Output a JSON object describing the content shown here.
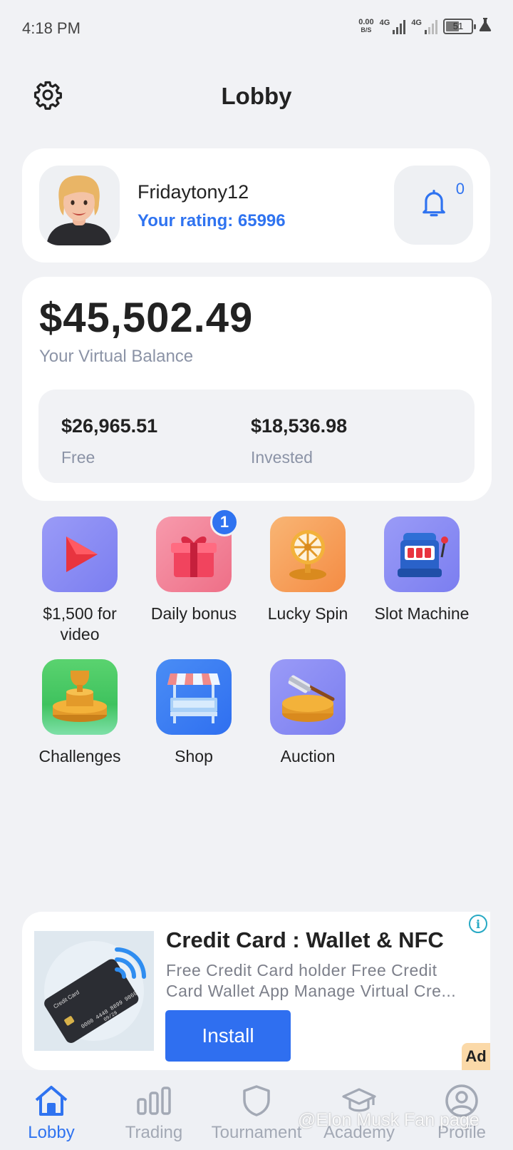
{
  "status_bar": {
    "time": "4:18 PM",
    "net_speed_value": "0.00",
    "net_speed_unit": "B/S",
    "signal_1": "4G",
    "signal_2": "4G",
    "battery": "51"
  },
  "header": {
    "title": "Lobby",
    "settings_icon": "gear-icon"
  },
  "profile": {
    "username": "Fridaytony12",
    "rating": "Your rating: 65996",
    "notification_count": "0",
    "bell_icon": "bell-icon"
  },
  "balance": {
    "amount": "$45,502.49",
    "label": "Your Virtual Balance",
    "free_value": "$26,965.51",
    "free_label": "Free",
    "invested_value": "$18,536.98",
    "invested_label": "Invested"
  },
  "features": [
    {
      "label": "$1,500 for video",
      "icon": "play-icon",
      "color": "#8b8cf5"
    },
    {
      "label": "Daily bonus",
      "icon": "gift-icon",
      "color": "#f27e96",
      "badge": "1"
    },
    {
      "label": "Lucky Spin",
      "icon": "wheel-icon",
      "color": "#f7a35c"
    },
    {
      "label": "Slot Machine",
      "icon": "slot-machine-icon",
      "color": "#8b8cf5"
    },
    {
      "label": "Challenges",
      "icon": "trophy-icon",
      "color": "#44c45e"
    },
    {
      "label": "Shop",
      "icon": "shop-icon",
      "color": "#3b7cf0"
    },
    {
      "label": "Auction",
      "icon": "gavel-icon",
      "color": "#8b8cf5"
    }
  ],
  "ad": {
    "title": "Credit Card : Wallet & NFC",
    "description": "Free Credit Card holder Free Credit Card Wallet App Manage Virtual Cre...",
    "install_label": "Install",
    "tag": "Ad",
    "info_glyph": "i",
    "card_label": "Credit Card",
    "card_number": "0000 4448 8899 9860",
    "card_expiry": "09/28"
  },
  "bottom_nav": [
    {
      "label": "Lobby",
      "icon": "home-icon",
      "active": true
    },
    {
      "label": "Trading",
      "icon": "bar-chart-icon",
      "active": false
    },
    {
      "label": "Tournament",
      "icon": "shield-icon",
      "active": false
    },
    {
      "label": "Academy",
      "icon": "graduation-cap-icon",
      "active": false
    },
    {
      "label": "Profile",
      "icon": "user-circle-icon",
      "active": false
    }
  ],
  "watermark": "@Elon Musk Fan page",
  "colors": {
    "accent": "#2f73f0",
    "background": "#f1f2f5",
    "muted_text": "#8b93a6"
  }
}
